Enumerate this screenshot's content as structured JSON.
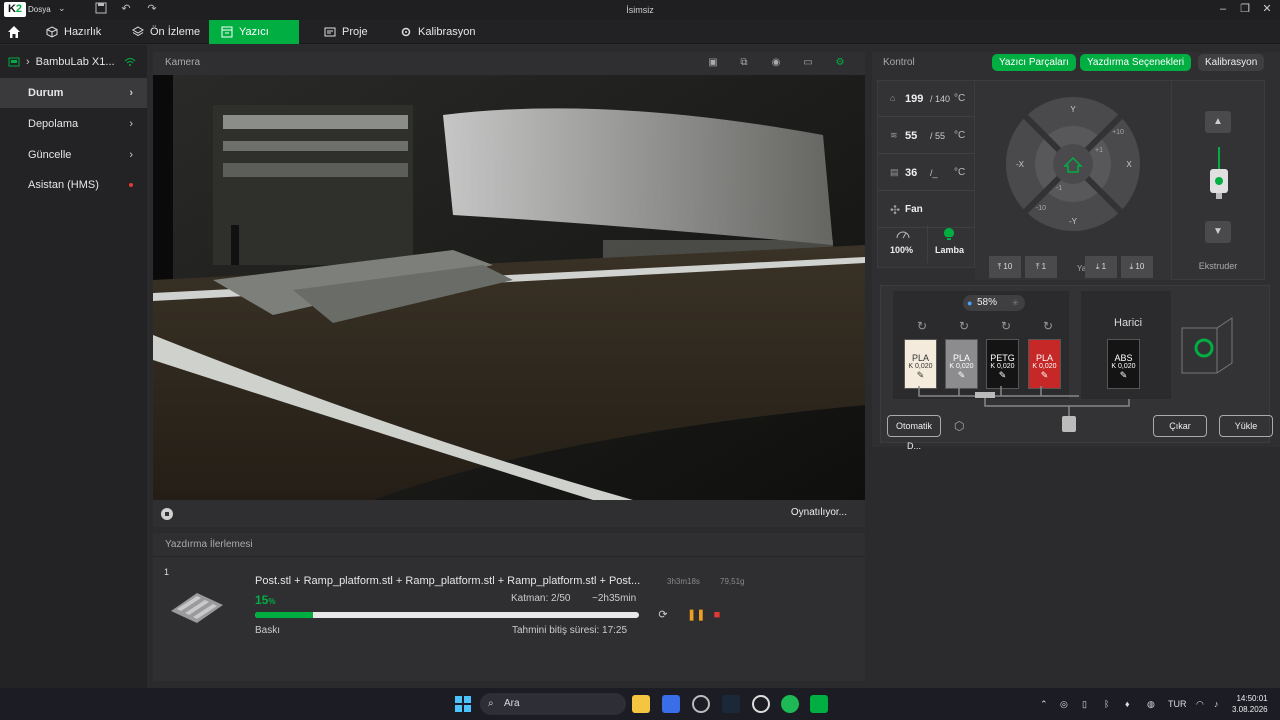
{
  "titlebar": {
    "logo": "K",
    "logo_accent": "2",
    "file_menu": "Dosya",
    "window_title": "İsimsiz"
  },
  "tabs": [
    {
      "label": "Hazırlık"
    },
    {
      "label": "Ön İzleme"
    },
    {
      "label": "Yazıcı"
    },
    {
      "label": "Proje"
    },
    {
      "label": "Kalibrasyon"
    }
  ],
  "sidebar": {
    "device_name": "BambuLab X1...",
    "items": [
      {
        "label": "Durum"
      },
      {
        "label": "Depolama"
      },
      {
        "label": "Güncelle"
      },
      {
        "label": "Asistan (HMS)"
      }
    ]
  },
  "camera": {
    "title": "Kamera",
    "status": "Oynatılıyor..."
  },
  "progress": {
    "title": "Yazdırma İlerlemesi",
    "index": "1",
    "file": "Post.stl + Ramp_platform.stl + Ramp_platform.stl + Ramp_platform.stl + Post...",
    "time_est": "3h3m18s",
    "weight": "79,51g",
    "percent": "15",
    "percent_unit": "%",
    "percent_value": 0.15,
    "layer": "Katman: 2/50",
    "remaining": "~2h35min",
    "stage": "Baskı",
    "eta": "Tahmini bitiş süresi: 17:25"
  },
  "control": {
    "title": "Kontrol",
    "buttons": [
      "Yazıcı Parçaları",
      "Yazdırma Seçenekleri",
      "Kalibrasyon"
    ],
    "temps": [
      {
        "value": "199",
        "target": "/ 140",
        "unit": "°C"
      },
      {
        "value": "55",
        "target": "/ 55",
        "unit": "°C"
      },
      {
        "value": "36",
        "target": "/_",
        "unit": "°C"
      }
    ],
    "fan_label": "Fan",
    "speed": "100%",
    "lamp": "Lamba",
    "dpad": {
      "y": "Y",
      "ny": "-Y",
      "x": "X",
      "nx": "-X",
      "p10": "+10",
      "p1": "+1",
      "m1": "-1",
      "m10": "-10"
    },
    "z_buttons": [
      "10",
      "1",
      "1",
      "10"
    ],
    "bed_label": "Yatak",
    "extruder_label": "Ekstruder"
  },
  "ams": {
    "humidity": "58",
    "humidity_unit": "%",
    "slots": [
      {
        "type": "PLA",
        "k": "K 0,020",
        "color": "#f5ebdc",
        "text": "#333"
      },
      {
        "type": "PLA",
        "k": "K 0,020",
        "color": "#8c8c8e",
        "text": "#fff"
      },
      {
        "type": "PETG",
        "k": "K 0,020",
        "color": "#141414",
        "text": "#fff"
      },
      {
        "type": "PLA",
        "k": "K 0,020",
        "color": "#c62828",
        "text": "#fff"
      }
    ],
    "external_label": "Harici",
    "external_slot": {
      "type": "ABS",
      "k": "K 0,020"
    },
    "auto_btn": "Otomatik D...",
    "unload": "Çıkar",
    "load": "Yükle"
  },
  "taskbar": {
    "search": "Ara",
    "lang": "TUR",
    "time": "14:50:01",
    "date": "3.08.2026"
  }
}
